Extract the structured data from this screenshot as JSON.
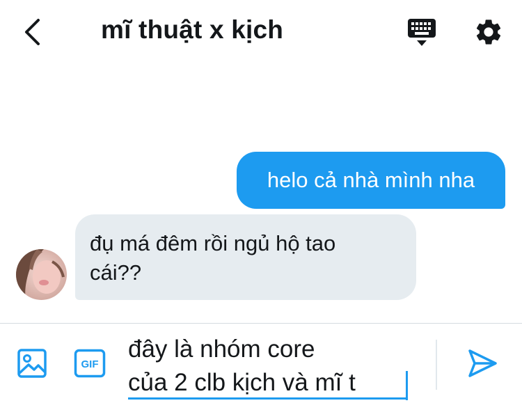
{
  "header": {
    "title": "mĩ thuật x kịch",
    "back_icon": "chevron-left-icon",
    "keyboard_icon": "keyboard-hide-icon",
    "settings_icon": "gear-icon"
  },
  "messages": [
    {
      "direction": "outgoing",
      "text": "helo cả nhà mình nha"
    },
    {
      "direction": "incoming",
      "lines": [
        "đụ má đêm rồi ngủ hộ tao",
        "cái??"
      ]
    }
  ],
  "composer": {
    "text_lines": [
      "đây là nhóm core",
      "của 2 clb kịch và mĩ t"
    ],
    "media_icon": "image-icon",
    "gif_label": "GIF",
    "send_icon": "send-icon"
  },
  "colors": {
    "accent": "#1d9bf0",
    "incoming_bubble": "#e6ecf0",
    "text": "#14171a",
    "divider": "#d4dbe0"
  }
}
